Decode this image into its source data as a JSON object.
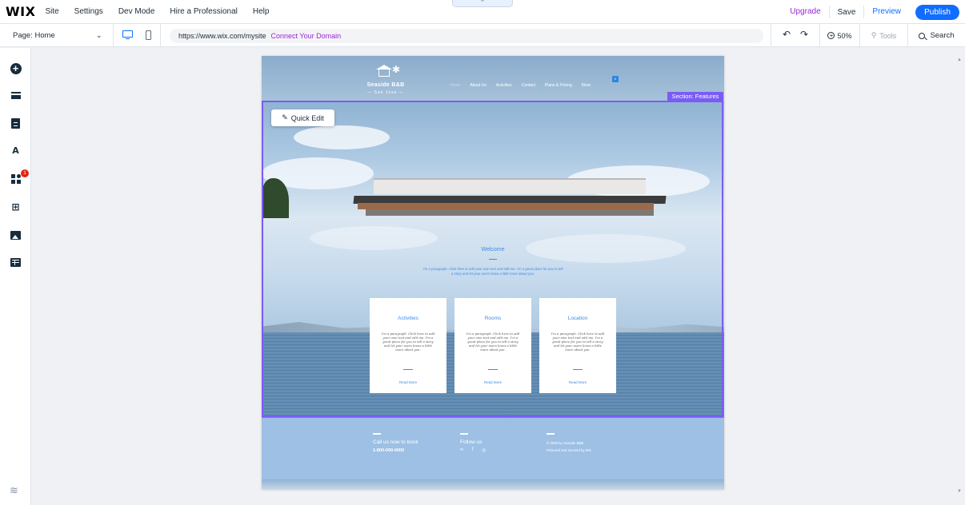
{
  "topbar": {
    "logo": "WIX",
    "menu": [
      "Site",
      "Settings",
      "Dev Mode",
      "Hire a Professional",
      "Help"
    ],
    "collapse_icon": "^",
    "upgrade": "Upgrade",
    "save": "Save",
    "preview": "Preview",
    "publish": "Publish"
  },
  "secondbar": {
    "page_label": "Page: Home",
    "chevron": "⌄",
    "url": "https://www.wix.com/mysite",
    "connect_domain": "Connect Your Domain",
    "undo": "↶",
    "redo": "↷",
    "zoom": "50%",
    "zoom_icon": "+",
    "tools": "Tools",
    "search": "Search"
  },
  "sidebar": {
    "add_icon": "+",
    "design_icon": "A",
    "apps_badge": "1",
    "business_icon": "⊞",
    "layers_icon": "≋"
  },
  "site": {
    "logo_name": "Seaside B&B",
    "logo_sub": "— San Jose —",
    "palm": "✱",
    "nav": [
      "Home",
      "About Us",
      "Activities",
      "Contact",
      "Plans & Pricing",
      "More"
    ],
    "cart_count": "0",
    "welcome_title": "Welcome",
    "welcome_para": "I'm a paragraph. Click here to add your own text and edit me. I'm a great place for you to tell a story and let your users know a little more about you.",
    "cards": [
      {
        "title": "Activities",
        "text": "I'm a paragraph. Click here to add your own text and edit me. I'm a great place for you to tell a story and let your users know a little more about you.",
        "more": "Read More"
      },
      {
        "title": "Rooms",
        "text": "I'm a paragraph. Click here to add your own text and edit me. I'm a great place for you to tell a story and let your users know a little more about you.",
        "more": "Read More"
      },
      {
        "title": "Location",
        "text": "I'm a paragraph. Click here to add your own text and edit me. I'm a great place for you to tell a story and let your users know a little more about you.",
        "more": "Read More"
      }
    ],
    "footer": {
      "call_label": "Call us now to book",
      "phone": "1-800-000-0000",
      "follow_label": "Follow us",
      "social_icons": [
        "∞",
        "f",
        "◎"
      ],
      "copyright": "© 2035 by Seaside B&B",
      "powered": "Powered and secured by Wix"
    }
  },
  "editor": {
    "section_label": "Section: Features",
    "quick_edit": "Quick Edit",
    "pencil": "✎",
    "scroll_up": "▲",
    "scroll_down": "▼"
  },
  "colors": {
    "accent": "#116dff",
    "upgrade": "#9a27d5",
    "selection": "#7a5cf5",
    "site_blue": "#3d8ce8"
  }
}
